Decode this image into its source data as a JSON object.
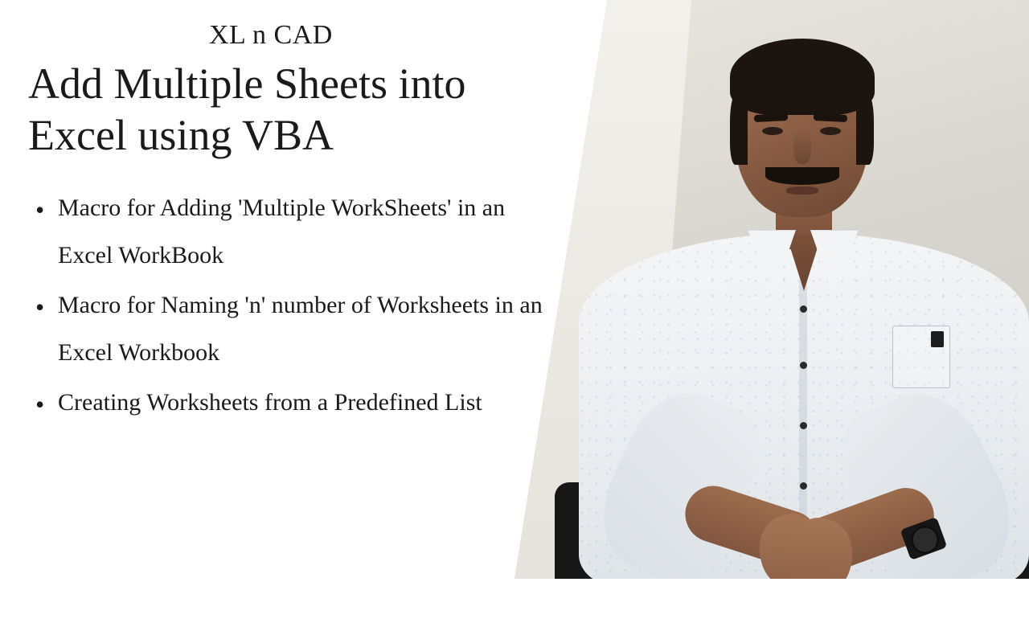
{
  "brand": "XL n CAD",
  "headline": "Add Multiple Sheets into Excel using VBA",
  "bullets": [
    "Macro for Adding 'Multiple WorkSheets' in an Excel WorkBook",
    "Macro for Naming 'n' number of Worksheets in an Excel Workbook",
    "Creating Worksheets from a Predefined List"
  ]
}
